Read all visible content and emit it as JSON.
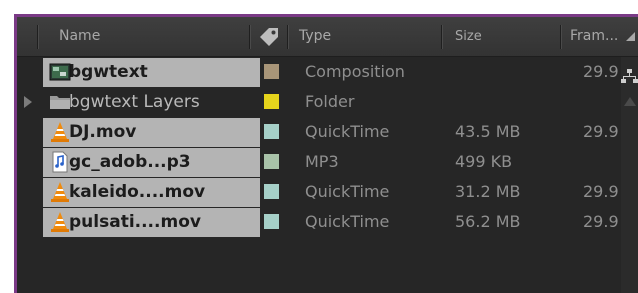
{
  "columns": {
    "name": "Name",
    "label_icon": "tag-icon",
    "type": "Type",
    "size": "Size",
    "frame_rate": "Fram..."
  },
  "items": [
    {
      "name": "bgwtext",
      "icon": "composition-icon",
      "label_color": "#a89578",
      "type": "Composition",
      "size": "",
      "frame_rate": "29.9",
      "selected": true,
      "expandable": false
    },
    {
      "name": "bgwtext Layers",
      "icon": "folder-icon",
      "label_color": "#e6d41c",
      "type": "Folder",
      "size": "",
      "frame_rate": "",
      "selected": false,
      "expandable": true
    },
    {
      "name": "DJ.mov",
      "icon": "vlc-cone-icon",
      "label_color": "#a6d0c8",
      "type": "QuickTime",
      "size": "43.5 MB",
      "frame_rate": "29.9",
      "selected": true,
      "expandable": false
    },
    {
      "name": "gc_adob...p3",
      "icon": "audio-file-icon",
      "label_color": "#a9c3a9",
      "type": "MP3",
      "size": "499 KB",
      "frame_rate": "",
      "selected": true,
      "expandable": false
    },
    {
      "name": "kaleido....mov",
      "icon": "vlc-cone-icon",
      "label_color": "#a6d0c8",
      "type": "QuickTime",
      "size": "31.2 MB",
      "frame_rate": "29.9",
      "selected": true,
      "expandable": false
    },
    {
      "name": "pulsati....mov",
      "icon": "vlc-cone-icon",
      "label_color": "#a6d0c8",
      "type": "QuickTime",
      "size": "56.2 MB",
      "frame_rate": "29.9",
      "selected": true,
      "expandable": false
    }
  ]
}
